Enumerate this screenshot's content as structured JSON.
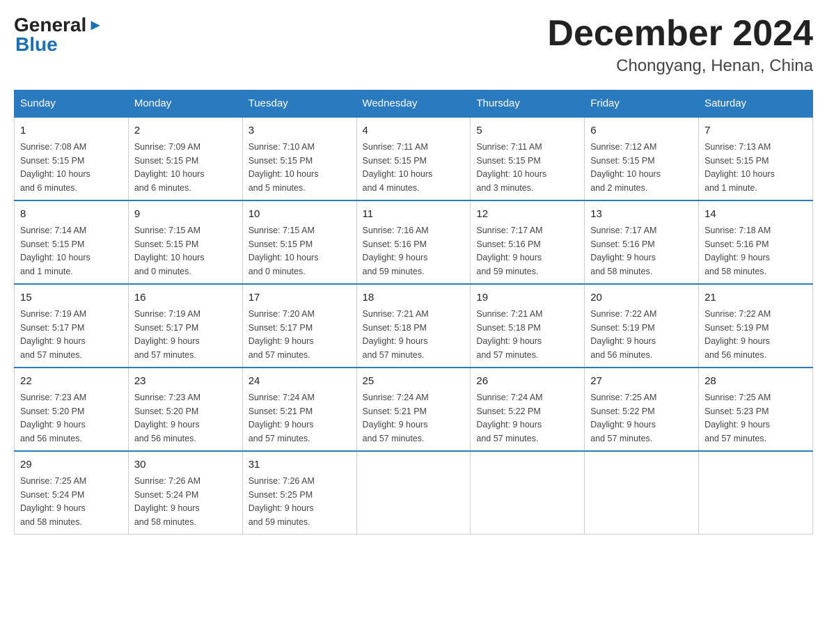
{
  "header": {
    "logo_general": "General",
    "logo_blue": "Blue",
    "main_title": "December 2024",
    "subtitle": "Chongyang, Henan, China"
  },
  "days_of_week": [
    "Sunday",
    "Monday",
    "Tuesday",
    "Wednesday",
    "Thursday",
    "Friday",
    "Saturday"
  ],
  "weeks": [
    [
      {
        "day": "1",
        "info": "Sunrise: 7:08 AM\nSunset: 5:15 PM\nDaylight: 10 hours\nand 6 minutes."
      },
      {
        "day": "2",
        "info": "Sunrise: 7:09 AM\nSunset: 5:15 PM\nDaylight: 10 hours\nand 6 minutes."
      },
      {
        "day": "3",
        "info": "Sunrise: 7:10 AM\nSunset: 5:15 PM\nDaylight: 10 hours\nand 5 minutes."
      },
      {
        "day": "4",
        "info": "Sunrise: 7:11 AM\nSunset: 5:15 PM\nDaylight: 10 hours\nand 4 minutes."
      },
      {
        "day": "5",
        "info": "Sunrise: 7:11 AM\nSunset: 5:15 PM\nDaylight: 10 hours\nand 3 minutes."
      },
      {
        "day": "6",
        "info": "Sunrise: 7:12 AM\nSunset: 5:15 PM\nDaylight: 10 hours\nand 2 minutes."
      },
      {
        "day": "7",
        "info": "Sunrise: 7:13 AM\nSunset: 5:15 PM\nDaylight: 10 hours\nand 1 minute."
      }
    ],
    [
      {
        "day": "8",
        "info": "Sunrise: 7:14 AM\nSunset: 5:15 PM\nDaylight: 10 hours\nand 1 minute."
      },
      {
        "day": "9",
        "info": "Sunrise: 7:15 AM\nSunset: 5:15 PM\nDaylight: 10 hours\nand 0 minutes."
      },
      {
        "day": "10",
        "info": "Sunrise: 7:15 AM\nSunset: 5:15 PM\nDaylight: 10 hours\nand 0 minutes."
      },
      {
        "day": "11",
        "info": "Sunrise: 7:16 AM\nSunset: 5:16 PM\nDaylight: 9 hours\nand 59 minutes."
      },
      {
        "day": "12",
        "info": "Sunrise: 7:17 AM\nSunset: 5:16 PM\nDaylight: 9 hours\nand 59 minutes."
      },
      {
        "day": "13",
        "info": "Sunrise: 7:17 AM\nSunset: 5:16 PM\nDaylight: 9 hours\nand 58 minutes."
      },
      {
        "day": "14",
        "info": "Sunrise: 7:18 AM\nSunset: 5:16 PM\nDaylight: 9 hours\nand 58 minutes."
      }
    ],
    [
      {
        "day": "15",
        "info": "Sunrise: 7:19 AM\nSunset: 5:17 PM\nDaylight: 9 hours\nand 57 minutes."
      },
      {
        "day": "16",
        "info": "Sunrise: 7:19 AM\nSunset: 5:17 PM\nDaylight: 9 hours\nand 57 minutes."
      },
      {
        "day": "17",
        "info": "Sunrise: 7:20 AM\nSunset: 5:17 PM\nDaylight: 9 hours\nand 57 minutes."
      },
      {
        "day": "18",
        "info": "Sunrise: 7:21 AM\nSunset: 5:18 PM\nDaylight: 9 hours\nand 57 minutes."
      },
      {
        "day": "19",
        "info": "Sunrise: 7:21 AM\nSunset: 5:18 PM\nDaylight: 9 hours\nand 57 minutes."
      },
      {
        "day": "20",
        "info": "Sunrise: 7:22 AM\nSunset: 5:19 PM\nDaylight: 9 hours\nand 56 minutes."
      },
      {
        "day": "21",
        "info": "Sunrise: 7:22 AM\nSunset: 5:19 PM\nDaylight: 9 hours\nand 56 minutes."
      }
    ],
    [
      {
        "day": "22",
        "info": "Sunrise: 7:23 AM\nSunset: 5:20 PM\nDaylight: 9 hours\nand 56 minutes."
      },
      {
        "day": "23",
        "info": "Sunrise: 7:23 AM\nSunset: 5:20 PM\nDaylight: 9 hours\nand 56 minutes."
      },
      {
        "day": "24",
        "info": "Sunrise: 7:24 AM\nSunset: 5:21 PM\nDaylight: 9 hours\nand 57 minutes."
      },
      {
        "day": "25",
        "info": "Sunrise: 7:24 AM\nSunset: 5:21 PM\nDaylight: 9 hours\nand 57 minutes."
      },
      {
        "day": "26",
        "info": "Sunrise: 7:24 AM\nSunset: 5:22 PM\nDaylight: 9 hours\nand 57 minutes."
      },
      {
        "day": "27",
        "info": "Sunrise: 7:25 AM\nSunset: 5:22 PM\nDaylight: 9 hours\nand 57 minutes."
      },
      {
        "day": "28",
        "info": "Sunrise: 7:25 AM\nSunset: 5:23 PM\nDaylight: 9 hours\nand 57 minutes."
      }
    ],
    [
      {
        "day": "29",
        "info": "Sunrise: 7:25 AM\nSunset: 5:24 PM\nDaylight: 9 hours\nand 58 minutes."
      },
      {
        "day": "30",
        "info": "Sunrise: 7:26 AM\nSunset: 5:24 PM\nDaylight: 9 hours\nand 58 minutes."
      },
      {
        "day": "31",
        "info": "Sunrise: 7:26 AM\nSunset: 5:25 PM\nDaylight: 9 hours\nand 59 minutes."
      },
      null,
      null,
      null,
      null
    ]
  ]
}
